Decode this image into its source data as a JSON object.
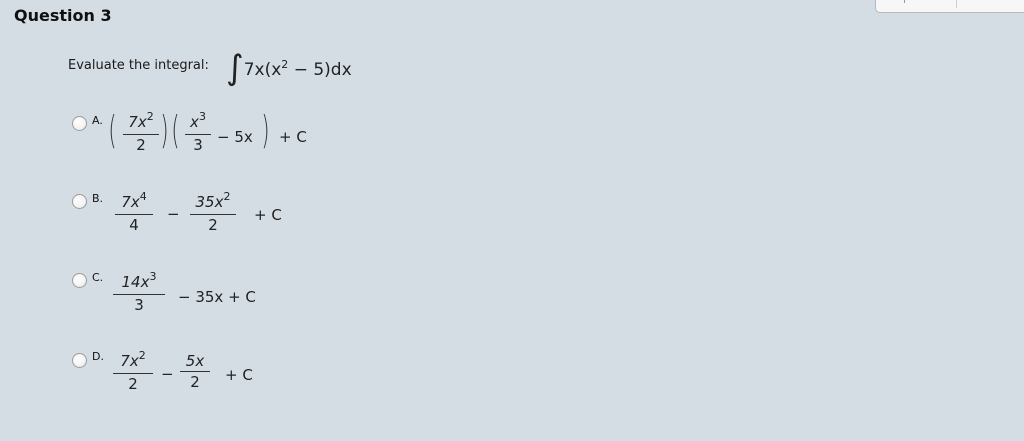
{
  "question": {
    "title": "Question 3",
    "prompt": "Evaluate the integral:",
    "integrand": {
      "integral_sign": "∫",
      "body": "7x(x",
      "exp": "2",
      "tail": " − 5)dx"
    }
  },
  "options": [
    {
      "label": "A.",
      "frac1": {
        "num": "7x",
        "num_exp": "2",
        "den": "2"
      },
      "frac2": {
        "num": "x",
        "num_exp": "3",
        "den": "3"
      },
      "after": "− 5x",
      "constant": "+ C"
    },
    {
      "label": "B.",
      "frac1": {
        "num": "7x",
        "num_exp": "4",
        "den": "4"
      },
      "op": "−",
      "frac2": {
        "num": "35x",
        "num_exp": "2",
        "den": "2"
      },
      "constant": "+ C"
    },
    {
      "label": "C.",
      "frac1": {
        "num": "14x",
        "num_exp": "3",
        "den": "3"
      },
      "after": "− 35x + C"
    },
    {
      "label": "D.",
      "frac1": {
        "num": "7x",
        "num_exp": "2",
        "den": "2"
      },
      "op": "−",
      "frac2": {
        "num": "5x",
        "den": "2"
      },
      "constant": "+ C"
    }
  ]
}
